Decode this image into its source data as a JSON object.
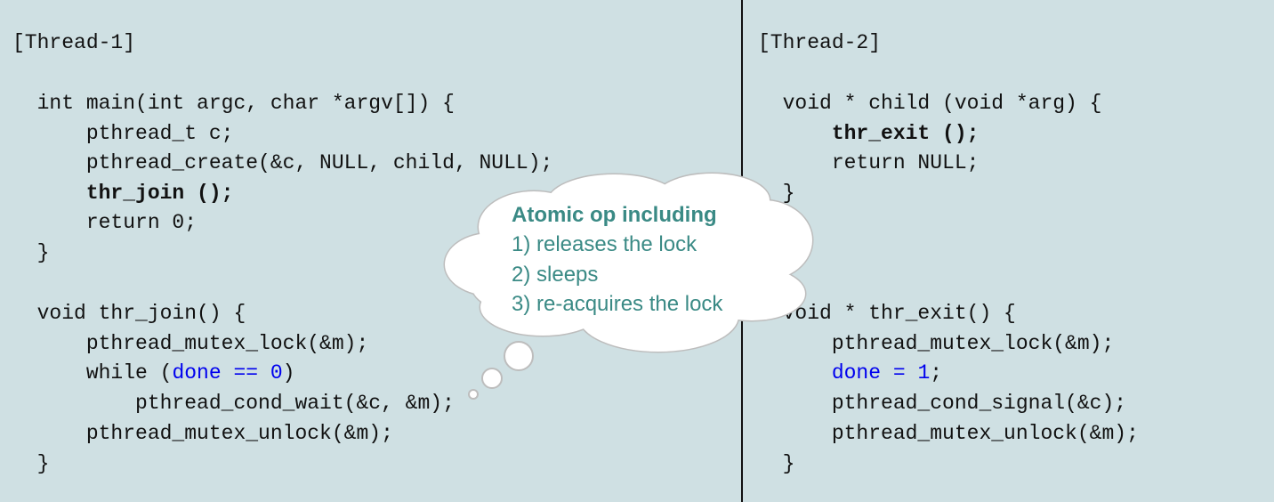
{
  "thread1": {
    "header": "[Thread-1]",
    "lines": [
      "  int main(int argc, char *argv[]) {",
      "      pthread_t c;",
      "      pthread_create(&c, NULL, child, NULL);",
      "      thr_join ();",
      "      return 0;",
      "  }",
      "  void thr_join() {",
      "      pthread_mutex_lock(&m);",
      "      while (",
      "done == 0",
      ")",
      "          pthread_cond_wait(&c, &m);",
      "      pthread_mutex_unlock(&m);",
      "  }"
    ]
  },
  "thread2": {
    "header": "[Thread-2]",
    "lines": [
      "  void * child (void *arg) {",
      "      thr_exit ();",
      "      return NULL;",
      "  }",
      "  void * thr_exit() {",
      "      pthread_mutex_lock(&m);",
      "      ",
      "done = 1",
      ";",
      "      pthread_cond_signal(&c);",
      "      pthread_mutex_unlock(&m);",
      "  }"
    ]
  },
  "callout": {
    "title": "Atomic op including",
    "items": [
      "1) releases the lock",
      "2) sleeps",
      "3) re-acquires the lock"
    ]
  },
  "colors": {
    "background": "#cfe0e3",
    "highlight": "#0000ee",
    "callout_text": "#3a8a85"
  }
}
